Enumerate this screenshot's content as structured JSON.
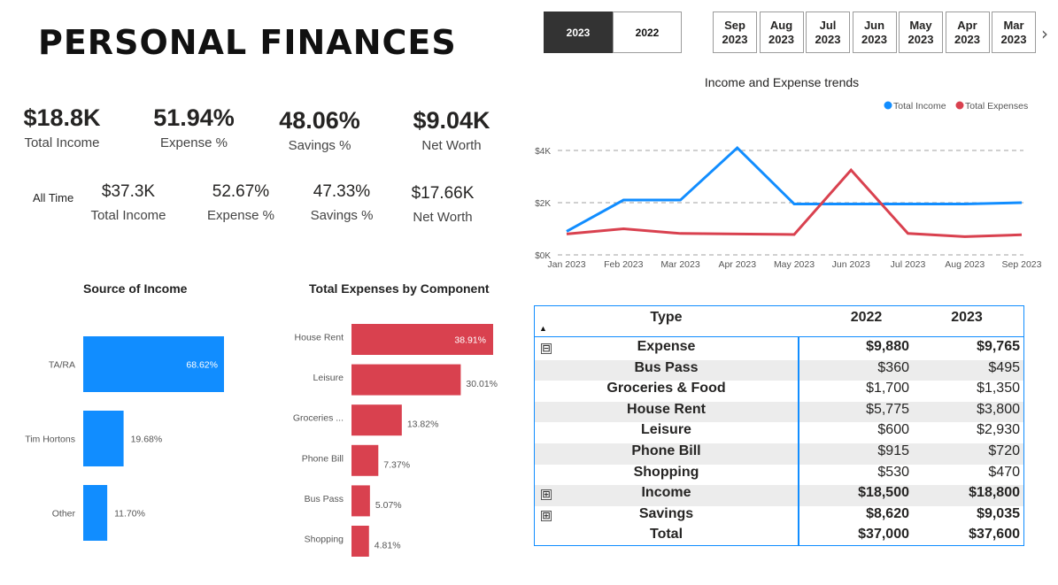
{
  "title": "PERSONAL FINANCES",
  "kpis_current": [
    {
      "value": "$18.8K",
      "label": "Total Income"
    },
    {
      "value": "51.94%",
      "label": "Expense %"
    },
    {
      "value": "48.06%",
      "label": "Savings %"
    },
    {
      "value": "$9.04K",
      "label": "Net Worth"
    }
  ],
  "all_time_label": "All Time",
  "kpis_all_time": [
    {
      "value": "$37.3K",
      "label": "Total Income"
    },
    {
      "value": "52.67%",
      "label": "Expense %"
    },
    {
      "value": "47.33%",
      "label": "Savings %"
    },
    {
      "value": "$17.66K",
      "label": "Net Worth"
    }
  ],
  "year_slicer": {
    "options": [
      "2023",
      "2022"
    ],
    "selected": "2023"
  },
  "month_slicer": {
    "options": [
      {
        "m": "Sep",
        "y": "2023"
      },
      {
        "m": "Aug",
        "y": "2023"
      },
      {
        "m": "Jul",
        "y": "2023"
      },
      {
        "m": "Jun",
        "y": "2023"
      },
      {
        "m": "May",
        "y": "2023"
      },
      {
        "m": "Apr",
        "y": "2023"
      },
      {
        "m": "Mar",
        "y": "2023"
      }
    ],
    "next_glyph": "›"
  },
  "colors": {
    "income": "#118dff",
    "expense": "#d9414f",
    "accent_dark": "#333333"
  },
  "chart_data": [
    {
      "type": "line",
      "title": "Income and Expense trends",
      "x": [
        "Jan 2023",
        "Feb 2023",
        "Mar 2023",
        "Apr 2023",
        "May 2023",
        "Jun 2023",
        "Jul 2023",
        "Aug 2023",
        "Sep 2023"
      ],
      "series": [
        {
          "name": "Total Income",
          "values": [
            900,
            2100,
            2100,
            4100,
            1950,
            1950,
            1950,
            1950,
            2000
          ]
        },
        {
          "name": "Total Expenses",
          "values": [
            800,
            1000,
            820,
            800,
            780,
            3250,
            820,
            700,
            770
          ]
        }
      ],
      "y_ticks": [
        "$0K",
        "$2K",
        "$4K"
      ],
      "ylim": [
        0,
        4000
      ],
      "grid": true,
      "legend": "top-right"
    },
    {
      "type": "bar",
      "orientation": "horizontal",
      "title": "Source of Income",
      "categories": [
        "TA/RA",
        "Tim Hortons",
        "Other"
      ],
      "values": [
        68.62,
        19.68,
        11.7
      ],
      "value_labels": [
        "68.62%",
        "19.68%",
        "11.70%"
      ]
    },
    {
      "type": "bar",
      "orientation": "horizontal",
      "title": "Total Expenses by Component",
      "categories": [
        "House Rent",
        "Leisure",
        "Groceries ...",
        "Phone Bill",
        "Bus Pass",
        "Shopping"
      ],
      "values": [
        38.91,
        30.01,
        13.82,
        7.37,
        5.07,
        4.81
      ],
      "value_labels": [
        "38.91%",
        "30.01%",
        "13.82%",
        "7.37%",
        "5.07%",
        "4.81%"
      ]
    },
    {
      "type": "table",
      "columns": [
        "Type",
        "2022",
        "2023"
      ],
      "rows": [
        {
          "type": "Expense",
          "v2022": "$9,880",
          "v2023": "$9,765",
          "level": 0,
          "toggle": "⊟",
          "bold": true
        },
        {
          "type": "Bus Pass",
          "v2022": "$360",
          "v2023": "$495",
          "level": 1,
          "toggle": "",
          "bold": false
        },
        {
          "type": "Groceries & Food",
          "v2022": "$1,700",
          "v2023": "$1,350",
          "level": 1,
          "toggle": "",
          "bold": false
        },
        {
          "type": "House Rent",
          "v2022": "$5,775",
          "v2023": "$3,800",
          "level": 1,
          "toggle": "",
          "bold": false
        },
        {
          "type": "Leisure",
          "v2022": "$600",
          "v2023": "$2,930",
          "level": 1,
          "toggle": "",
          "bold": false
        },
        {
          "type": "Phone Bill",
          "v2022": "$915",
          "v2023": "$720",
          "level": 1,
          "toggle": "",
          "bold": false
        },
        {
          "type": "Shopping",
          "v2022": "$530",
          "v2023": "$470",
          "level": 1,
          "toggle": "",
          "bold": false
        },
        {
          "type": "Income",
          "v2022": "$18,500",
          "v2023": "$18,800",
          "level": 0,
          "toggle": "⊞",
          "bold": true
        },
        {
          "type": "Savings",
          "v2022": "$8,620",
          "v2023": "$9,035",
          "level": 0,
          "toggle": "⊞",
          "bold": true
        },
        {
          "type": "Total",
          "v2022": "$37,000",
          "v2023": "$37,600",
          "level": 0,
          "toggle": "",
          "bold": true
        }
      ]
    }
  ]
}
